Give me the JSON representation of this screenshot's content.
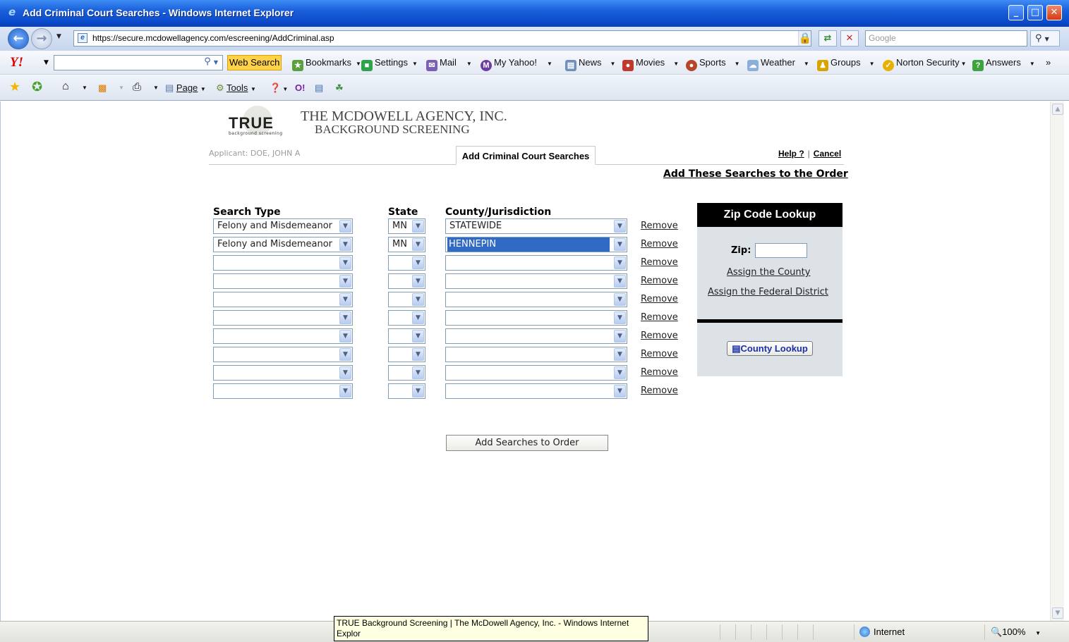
{
  "window": {
    "title": "Add Criminal Court Searches - Windows Internet Explorer",
    "buttons": {
      "minimize": "_",
      "maximize": "□",
      "close": "✕"
    }
  },
  "address_bar": {
    "url": "https://secure.mcdowellagency.com/escreening/AddCriminal.asp",
    "search_placeholder": "Google"
  },
  "yahoo_toolbar": {
    "logo": "Y!",
    "web_search": "Web Search",
    "items": [
      "Bookmarks",
      "Settings",
      "Mail",
      "My Yahoo!",
      "News",
      "Movies",
      "Sports",
      "Weather",
      "Groups",
      "Norton Security",
      "Answers"
    ],
    "more": "»"
  },
  "command_bar": {
    "page": "Page",
    "tools": "Tools"
  },
  "page": {
    "logo_text": "TRUE",
    "logo_sub": "background screening",
    "agency_line1": "THE MCDOWELL AGENCY, INC.",
    "agency_line2": "BACKGROUND SCREENING",
    "applicant": "Applicant: DOE, JOHN A",
    "tab_label": "Add Criminal Court Searches",
    "help_link": "Help ?",
    "link_separator": "|",
    "cancel_link": "Cancel",
    "add_these_link": "Add These Searches to the Order",
    "columns": {
      "search_type": "Search Type",
      "state": "State",
      "county": "County/Jurisdiction"
    },
    "rows": [
      {
        "search_type": "Felony and Misdemeanor",
        "state": "MN",
        "county": "STATEWIDE",
        "remove": "Remove"
      },
      {
        "search_type": "Felony and Misdemeanor",
        "state": "MN",
        "county": "HENNEPIN",
        "remove": "Remove",
        "county_highlighted": true
      },
      {
        "search_type": "",
        "state": "",
        "county": "",
        "remove": "Remove"
      },
      {
        "search_type": "",
        "state": "",
        "county": "",
        "remove": "Remove"
      },
      {
        "search_type": "",
        "state": "",
        "county": "",
        "remove": "Remove"
      },
      {
        "search_type": "",
        "state": "",
        "county": "",
        "remove": "Remove"
      },
      {
        "search_type": "",
        "state": "",
        "county": "",
        "remove": "Remove"
      },
      {
        "search_type": "",
        "state": "",
        "county": "",
        "remove": "Remove"
      },
      {
        "search_type": "",
        "state": "",
        "county": "",
        "remove": "Remove"
      },
      {
        "search_type": "",
        "state": "",
        "county": "",
        "remove": "Remove"
      }
    ],
    "add_button": "Add Searches to Order"
  },
  "zip_panel": {
    "title": "Zip Code Lookup",
    "zip_label": "Zip:",
    "zip_value": "",
    "assign_county": "Assign the County",
    "assign_federal": "Assign the Federal District",
    "county_lookup_button": "County Lookup"
  },
  "status_bar": {
    "tooltip": "TRUE Background Screening | The McDowell Agency, Inc. - Windows Internet Explor",
    "zone": "Internet",
    "zoom": "100%"
  },
  "colors": {
    "title_bar": "#1a5fd9",
    "highlight": "#316ac5",
    "panel_bg": "#dde2e6",
    "panel_header": "#000000",
    "tooltip_bg": "#ffffe1"
  }
}
